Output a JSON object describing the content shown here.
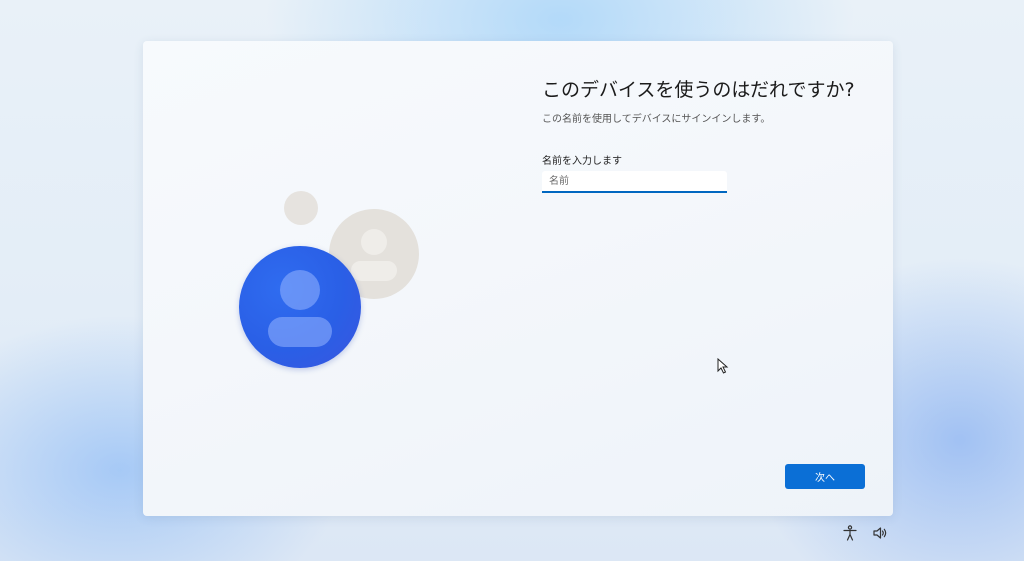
{
  "oobe": {
    "title": "このデバイスを使うのはだれですか?",
    "subtitle": "この名前を使用してデバイスにサインインします。",
    "field_label": "名前を入力します",
    "name_input": {
      "placeholder": "名前",
      "value": ""
    },
    "next_label": "次へ"
  },
  "icons": {
    "illustration": "user-avatars-illustration",
    "accessibility": "accessibility-icon",
    "volume": "volume-icon",
    "cursor": "mouse-cursor-icon"
  },
  "colors": {
    "accent": "#0b6fd6",
    "avatar_blue": "#2a5fe6",
    "avatar_gray": "#e4e1dc"
  }
}
